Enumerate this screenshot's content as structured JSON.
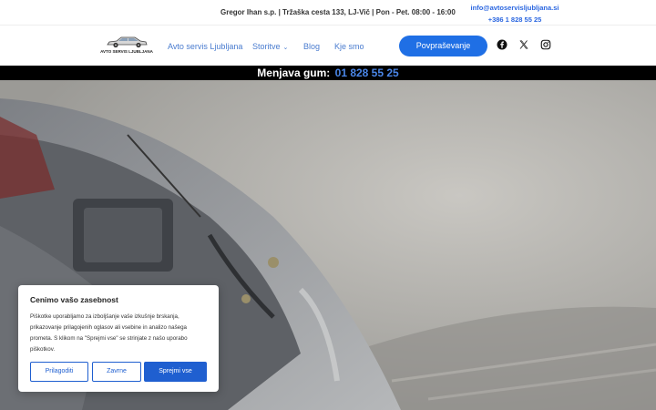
{
  "topbar": {
    "info": "Gregor Ihan s.p. | Tržaška cesta 133, LJ-Vič | Pon - Pet. 08:00 - 16:00",
    "email": "info@avtoservisljubljana.si",
    "phone": "+386 1 828 55 25"
  },
  "header": {
    "logo_text": "AVTO SERVIS LJUBLJANA",
    "nav": [
      {
        "label": "Avto servis Ljubljana"
      },
      {
        "label": "Storitve"
      },
      {
        "label": "Blog"
      },
      {
        "label": "Kje smo"
      }
    ],
    "cta_label": "Povpraševanje",
    "social_icons": [
      "facebook-icon",
      "x-icon",
      "instagram-icon"
    ]
  },
  "promo": {
    "label": "Menjava gum:",
    "phone": "01 828 55 25"
  },
  "cookie": {
    "title": "Cenimo vašo zasebnost",
    "text": "Piškotke uporabljamo za izboljšanje vaše izkušnje brskanja, prikazovanje prilagojenih oglasov ali vsebine in analizo našega prometa. S klikom na \"Sprejmi vse\" se strinjate z našo uporabo piškotkov.",
    "customize_label": "Prilagoditi",
    "reject_label": "Zavrne",
    "accept_label": "Sprejmi vse"
  },
  "colors": {
    "accent": "#1f6fe5",
    "link": "#4a7ccf",
    "promo_bg": "#000000"
  }
}
